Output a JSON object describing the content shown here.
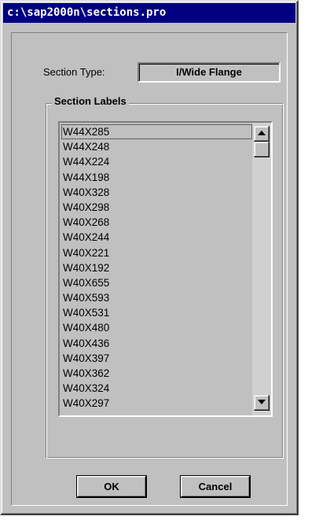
{
  "window": {
    "title": "c:\\sap2000n\\sections.pro"
  },
  "section_type": {
    "label": "Section Type:",
    "value": "I/Wide Flange"
  },
  "section_labels": {
    "title": "Section Labels",
    "selected_index": 0,
    "items": [
      "W44X285",
      "W44X248",
      "W44X224",
      "W44X198",
      "W40X328",
      "W40X298",
      "W40X268",
      "W40X244",
      "W40X221",
      "W40X192",
      "W40X655",
      "W40X593",
      "W40X531",
      "W40X480",
      "W40X436",
      "W40X397",
      "W40X362",
      "W40X324",
      "W40X297"
    ]
  },
  "buttons": {
    "ok": "OK",
    "cancel": "Cancel"
  },
  "icons": {
    "scroll_up": "arrow-up-icon",
    "scroll_down": "arrow-down-icon"
  }
}
